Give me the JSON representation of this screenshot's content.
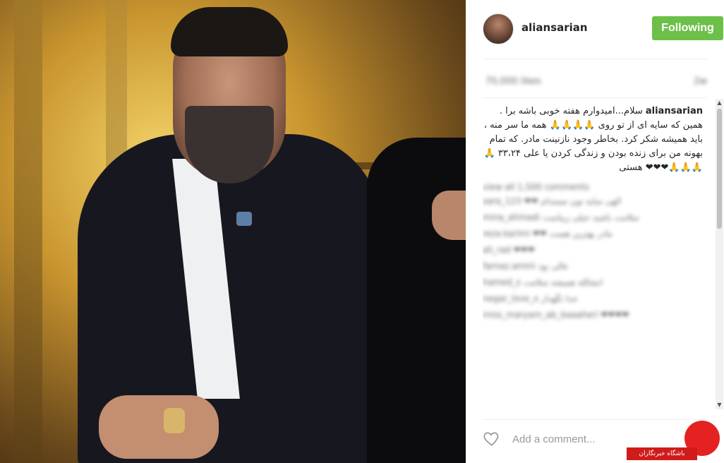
{
  "post": {
    "username": "aliansarian",
    "follow_label": "Following",
    "likes_blurred": "70,000 likes",
    "time_blurred": "2w",
    "caption_username": "aliansarian",
    "caption_text": "سلام...امیدوارم هفته خوبی باشه برا . همین که سایه ای از تو روی 🙏🙏🙏🙏 همه ما سر منه ، باید همیشه شکر کرد. بخاطر وجود نازنینت مادر. که تمام بهونه من برای زنده بودن و زندگی کردن یا علی ۳۳،۲۴ 🙏🙏🙏🙏❤❤❤ هستی",
    "view_all_blurred": "view all 1,500 comments",
    "comments_blurred": [
      "sara_123 ❤❤ الهی سایه تون مستدام",
      "mina_ahmadi سلامت باشید خیلی زیباست",
      "reza.karimi ❤❤ مادر بهترین هست",
      "ali_rad ❤❤❤",
      "farnaz.amini عالی بود",
      "hamed_s انشالله همیشه سلامت",
      "negar_love_x خدا نگهدار",
      "miss_maryam_ab_baaaheri ❤❤❤❤"
    ],
    "add_comment_placeholder": "Add a comment..."
  },
  "watermark": {
    "label": "باشگاه خبرنگاران"
  },
  "icons": {
    "heart": "heart-icon",
    "scroll_up": "scroll-up-arrow-icon",
    "scroll_down": "scroll-down-arrow-icon"
  }
}
